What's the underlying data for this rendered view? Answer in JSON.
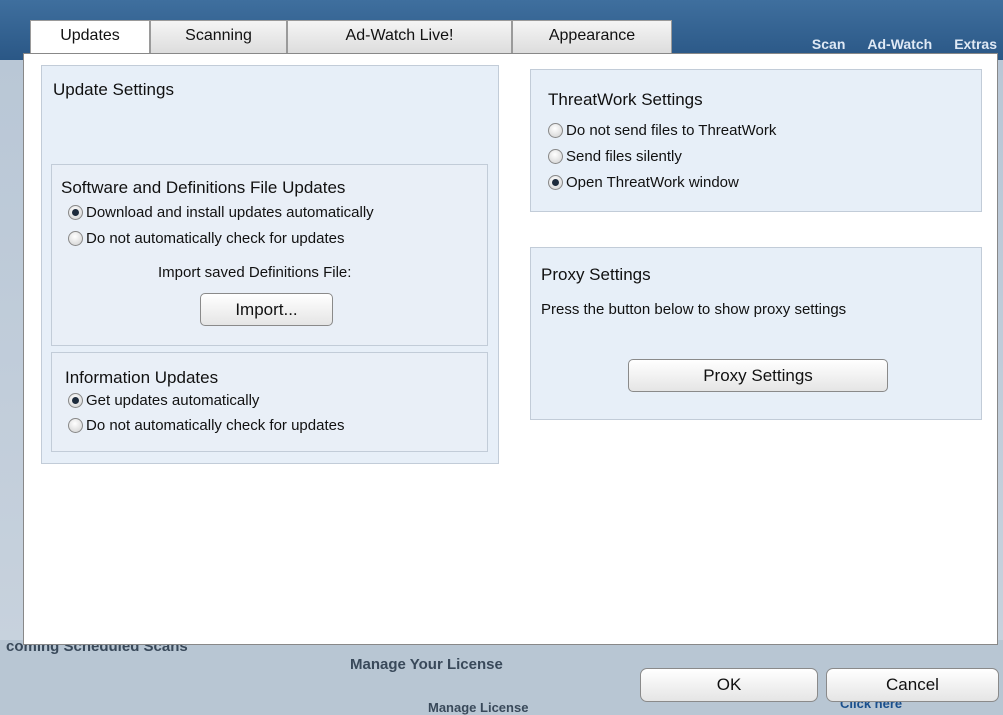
{
  "tabs": [
    {
      "label": "Updates"
    },
    {
      "label": "Scanning"
    },
    {
      "label": "Ad-Watch Live!"
    },
    {
      "label": "Appearance"
    }
  ],
  "background": {
    "nav": [
      "Scan",
      "Ad-Watch",
      "Extras"
    ],
    "bottom_left": "coming Scheduled Scans",
    "bottom_mid": "Manage Your License",
    "bottom_btn": "Manage License",
    "bottom_right": "Click here"
  },
  "update_settings": {
    "title": "Update Settings",
    "software": {
      "title": "Software and Definitions File Updates",
      "options": [
        "Download and install updates automatically",
        "Do not automatically check for updates"
      ],
      "selected": 0,
      "import_label": "Import saved Definitions File:",
      "import_button": "Import..."
    },
    "information": {
      "title": "Information Updates",
      "options": [
        "Get updates automatically",
        "Do not automatically check for updates"
      ],
      "selected": 0
    }
  },
  "threatwork": {
    "title": "ThreatWork Settings",
    "options": [
      "Do not send files to ThreatWork",
      "Send files silently",
      "Open ThreatWork window"
    ],
    "selected": 2
  },
  "proxy": {
    "title": "Proxy Settings",
    "description": "Press the button below to show proxy settings",
    "button": "Proxy Settings"
  },
  "footer": {
    "ok": "OK",
    "cancel": "Cancel"
  }
}
